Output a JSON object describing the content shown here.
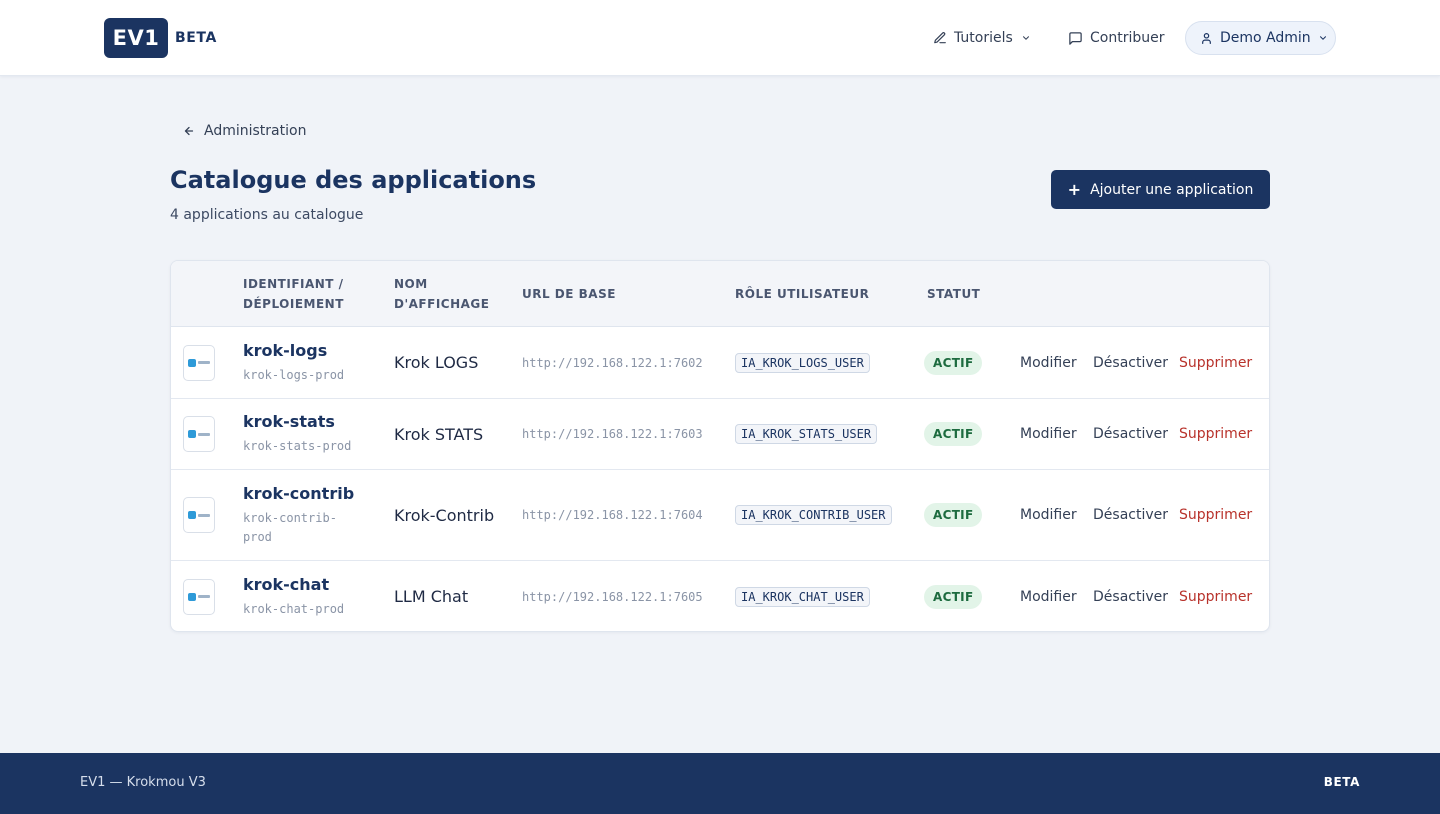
{
  "brand": {
    "logo": "EV1",
    "badge": "BETA"
  },
  "nav": {
    "tutorials": "Tutoriels",
    "contribute": "Contribuer",
    "user": "Demo Admin"
  },
  "breadcrumb": {
    "back_label": "Administration"
  },
  "page": {
    "title": "Catalogue des applications",
    "subtitle": "4 applications au catalogue",
    "add_button": "Ajouter une application"
  },
  "table": {
    "headers": {
      "ident": "IDENTIFIANT / DÉPLOIEMENT",
      "display": "NOM D'AFFICHAGE",
      "url": "URL DE BASE",
      "role": "RÔLE UTILISATEUR",
      "status": "STATUT"
    },
    "rows": [
      {
        "ident": "krok-logs",
        "deployment": "krok-logs-prod",
        "display": "Krok LOGS",
        "url": "http://192.168.122.1:7602",
        "role": "IA_KROK_LOGS_USER",
        "status": "ACTIF",
        "icon": "krok-logs-logo-icon"
      },
      {
        "ident": "krok-stats",
        "deployment": "krok-stats-prod",
        "display": "Krok STATS",
        "url": "http://192.168.122.1:7603",
        "role": "IA_KROK_STATS_USER",
        "status": "ACTIF",
        "icon": "krok-stats-logo-icon"
      },
      {
        "ident": "krok-contrib",
        "deployment": "krok-contrib-prod",
        "display": "Krok-Contrib",
        "url": "http://192.168.122.1:7604",
        "role": "IA_KROK_CONTRIB_USER",
        "status": "ACTIF",
        "icon": "krok-contrib-logo-icon"
      },
      {
        "ident": "krok-chat",
        "deployment": "krok-chat-prod",
        "display": "LLM Chat",
        "url": "http://192.168.122.1:7605",
        "role": "IA_KROK_CHAT_USER",
        "status": "ACTIF",
        "icon": "llm-chat-logo-icon"
      }
    ],
    "actions": {
      "edit": "Modifier",
      "deactivate": "Désactiver",
      "delete": "Supprimer"
    }
  },
  "footer": {
    "left": "EV1 — Krokmou V3",
    "right": "BETA"
  },
  "colors": {
    "primary": "#1b3461",
    "danger": "#b8322b",
    "success": "#1d6b3f",
    "background": "#f0f3f8"
  }
}
